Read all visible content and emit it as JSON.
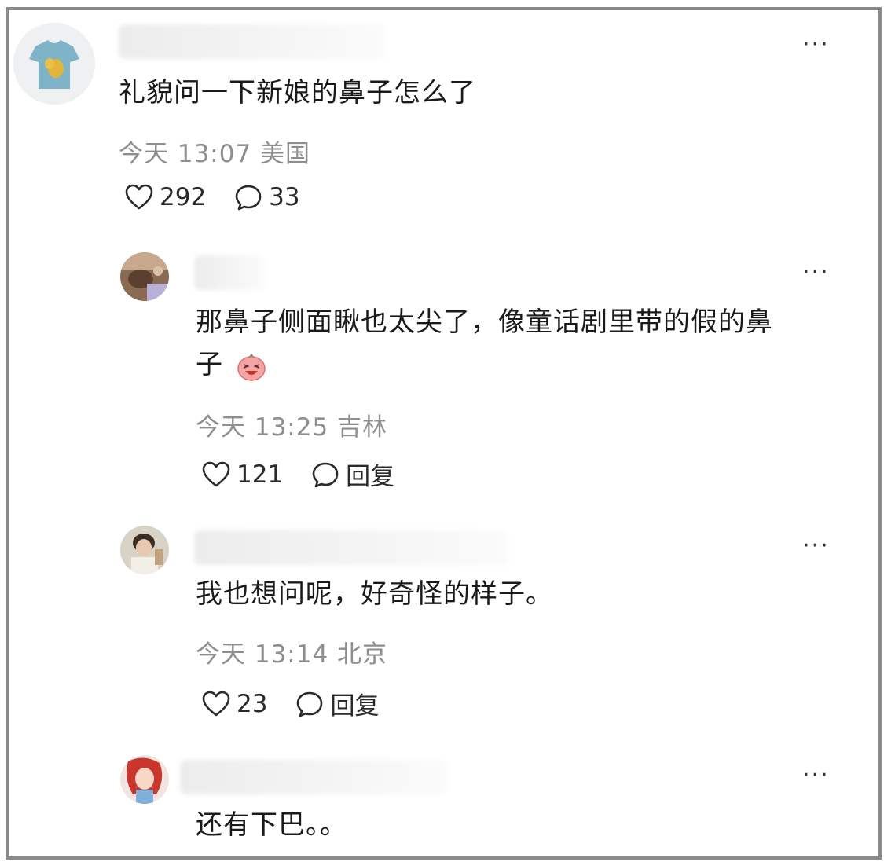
{
  "comments": [
    {
      "text": "礼貌问一下新娘的鼻子怎么了",
      "time": "今天 13:07",
      "location": "美国",
      "likes": "292",
      "replies": "33",
      "more": "···"
    },
    {
      "text_line1": "那鼻子侧面瞅也太尖了，像童话剧里带的假的鼻",
      "text_line2": "子",
      "emoji": "laughing-emoji-icon",
      "time": "今天 13:25",
      "location": "吉林",
      "likes": "121",
      "reply_label": "回复",
      "more": "···"
    },
    {
      "text": "我也想问呢，好奇怪的样子。",
      "time": "今天 13:14",
      "location": "北京",
      "likes": "23",
      "reply_label": "回复",
      "more": "···"
    },
    {
      "text": "还有下巴。。",
      "more": "···"
    }
  ],
  "colors": {
    "frame_border": "#8a8a8a",
    "text": "#1a1a1a",
    "meta": "#8e8e8e",
    "icon": "#2a2a2a"
  }
}
